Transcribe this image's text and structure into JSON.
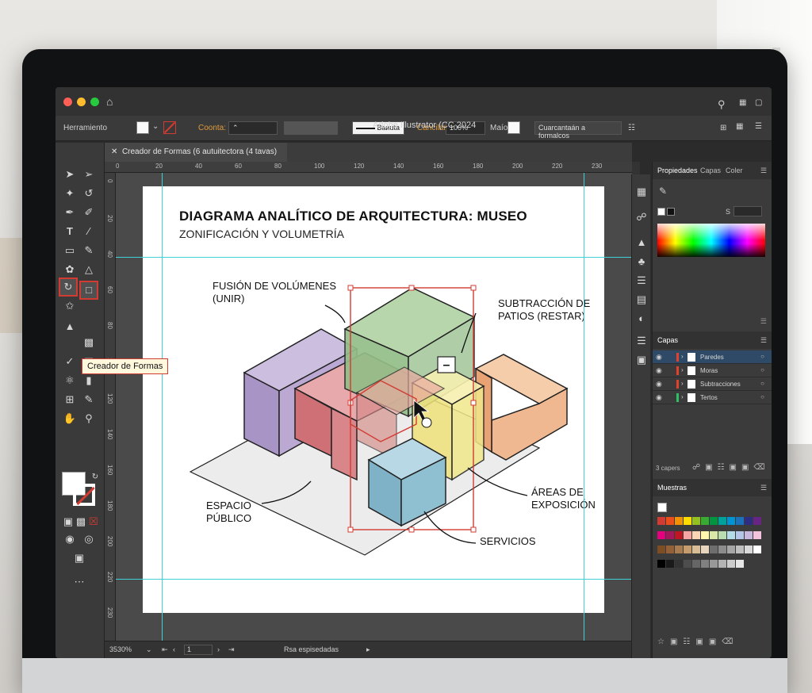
{
  "app": {
    "title": "Adobe Illustrator (CC 2024",
    "tool_name_label": "Herramiento",
    "opacity_label": "Coonta:",
    "stroke_style_label": "Ваиuta",
    "opacity2_label": "Cancilar:",
    "opacity_value": "100%",
    "style_label": "Маío:",
    "transform_button": "Cuarcantaán a formalcos"
  },
  "document_tab": {
    "label": "Creador de Formas (6 autuitectora (4 tavas)"
  },
  "tooltip": {
    "text": "Creador de Formas"
  },
  "ruler": {
    "top_ticks": [
      "0",
      "20",
      "40",
      "60",
      "80",
      "100",
      "120",
      "140",
      "160",
      "180",
      "200",
      "220",
      "230"
    ],
    "left_ticks": [
      "0",
      "20",
      "40",
      "60",
      "80",
      "100",
      "120",
      "140",
      "160",
      "180",
      "200",
      "220",
      "230"
    ]
  },
  "artboard": {
    "title": "DIAGRAMA ANALÍTICO DE ARQUITECTURA: MUSEO",
    "subtitle": "ZONIFICACIÓN Y VOLUMETRÍA",
    "labels": {
      "fusion": "FUSIÓN DE VOLÚMENES\n(UNIR)",
      "subtraccion": "SUBTRACCIÓN DE\nPATIOS (RESTAR)",
      "espacio": "ESPACIO\nPÚBLICO",
      "areas": "ÁREAS DE\nEXPOSICIÓN",
      "servicios": "SERVICIOS"
    },
    "minus_badge": "–"
  },
  "statusbar": {
    "zoom": "3530%",
    "page": "1",
    "status_text": "Rsa espisedadas"
  },
  "panels": {
    "top_tabs": [
      "Propiedades",
      "Capas",
      "Coler"
    ],
    "color_value_label": "S",
    "layers_tab": "Capas",
    "layers": [
      {
        "name": "Paredes",
        "color": "#e2422c",
        "selected": true
      },
      {
        "name": "Moras",
        "color": "#e2422c",
        "selected": false
      },
      {
        "name": "Subtracciones",
        "color": "#e2422c",
        "selected": false
      },
      {
        "name": "Tertos",
        "color": "#2fbf65",
        "selected": false
      }
    ],
    "layers_count": "3 capers",
    "swatches_tab": "Muestras"
  },
  "colors": {
    "accent_red": "#d23b32",
    "guide": "#3fd0d8",
    "purple": "#b9a6cf",
    "green": "#a9caa0",
    "red": "#d9868b",
    "yellow": "#f1e88b",
    "blue": "#8fc0d2",
    "orange": "#f0b890"
  },
  "icons": {
    "toolbar": [
      "selection-tool-icon",
      "direct-selection-tool-icon",
      "magic-wand-icon",
      "lasso-icon",
      "pen-icon",
      "brush-icon",
      "type-icon",
      "line-icon",
      "rectangle-icon",
      "pencil-icon",
      "eraser-icon",
      "rotate-icon",
      "scale-icon",
      "shape-builder-icon",
      "gradient-icon",
      "eyedropper-icon",
      "graph-icon",
      "artboard-icon",
      "slice-icon",
      "hand-icon",
      "zoom-icon"
    ]
  }
}
